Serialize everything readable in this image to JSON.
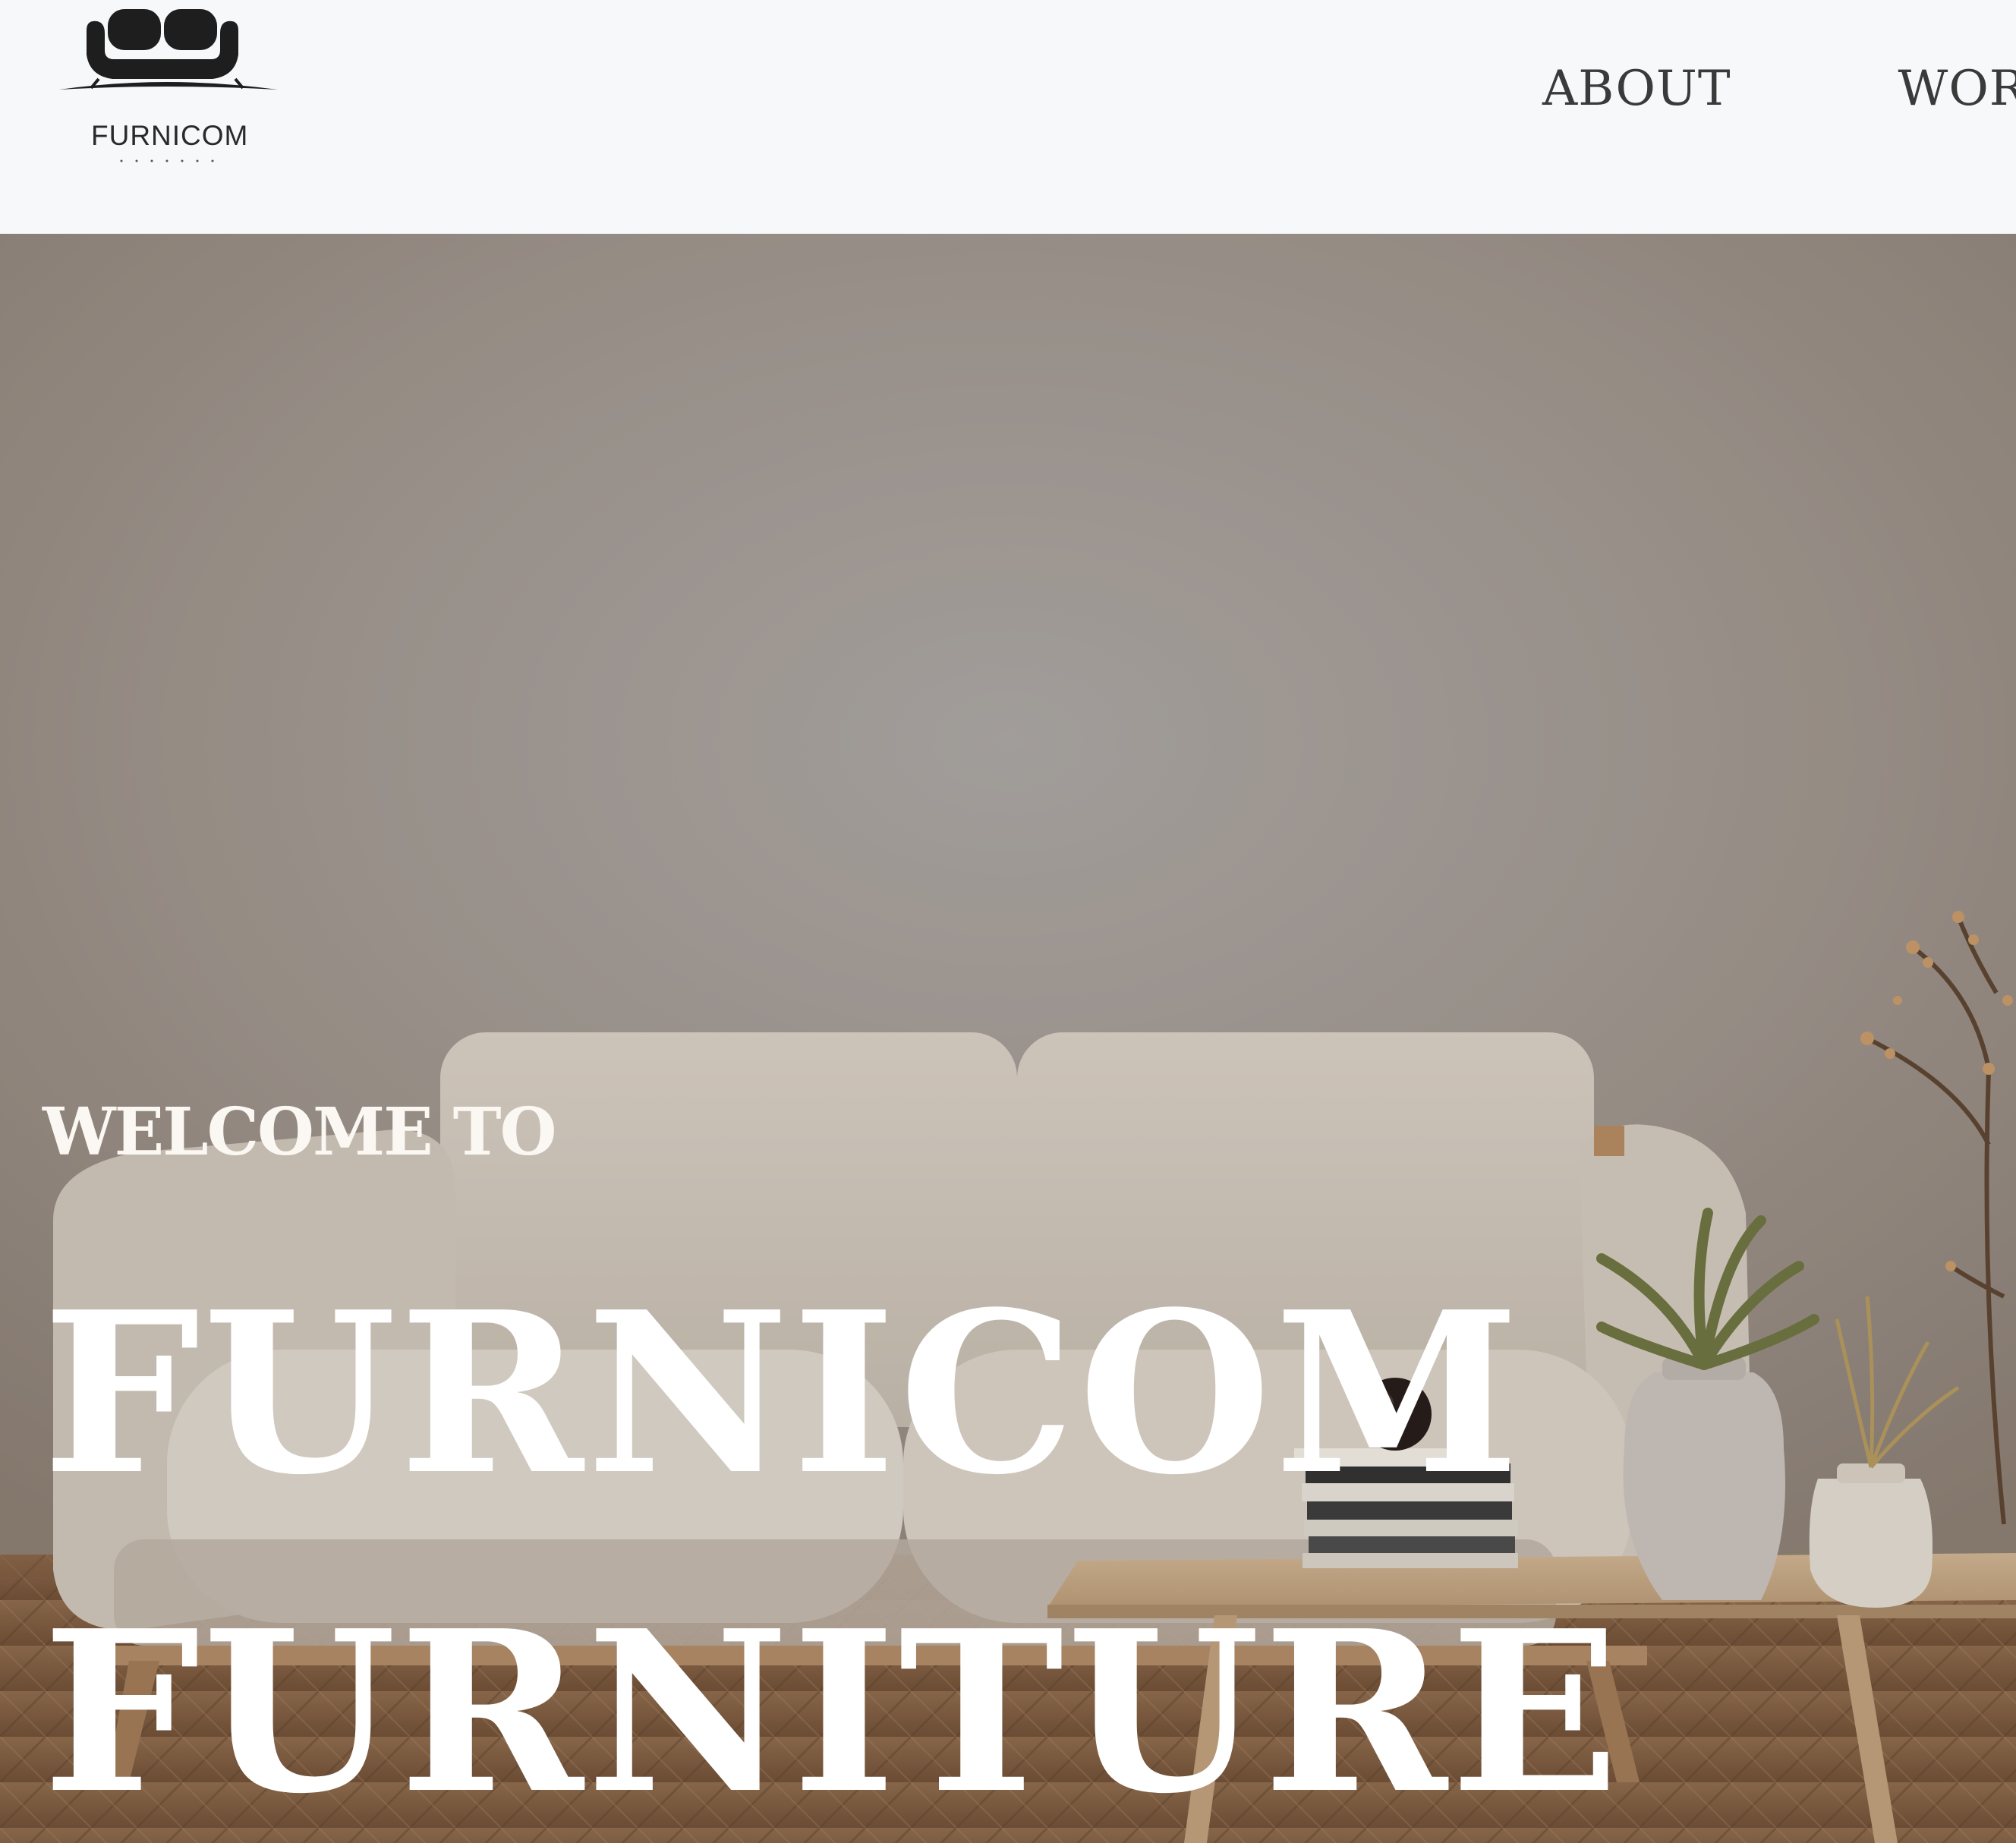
{
  "brand": {
    "logo_text": "FURNICOM",
    "logo_icon": "sofa-icon"
  },
  "nav": {
    "items": [
      {
        "label": "ABOUT"
      },
      {
        "label": "WORK"
      }
    ]
  },
  "hero": {
    "kicker": "WELCOME TO",
    "title_line_1": "FURNICOM",
    "title_line_2": "FURNITURE"
  },
  "colors": {
    "header_bg": "#f7f8fa",
    "nav_text": "#3a3a3a",
    "hero_text": "#ffffff"
  }
}
